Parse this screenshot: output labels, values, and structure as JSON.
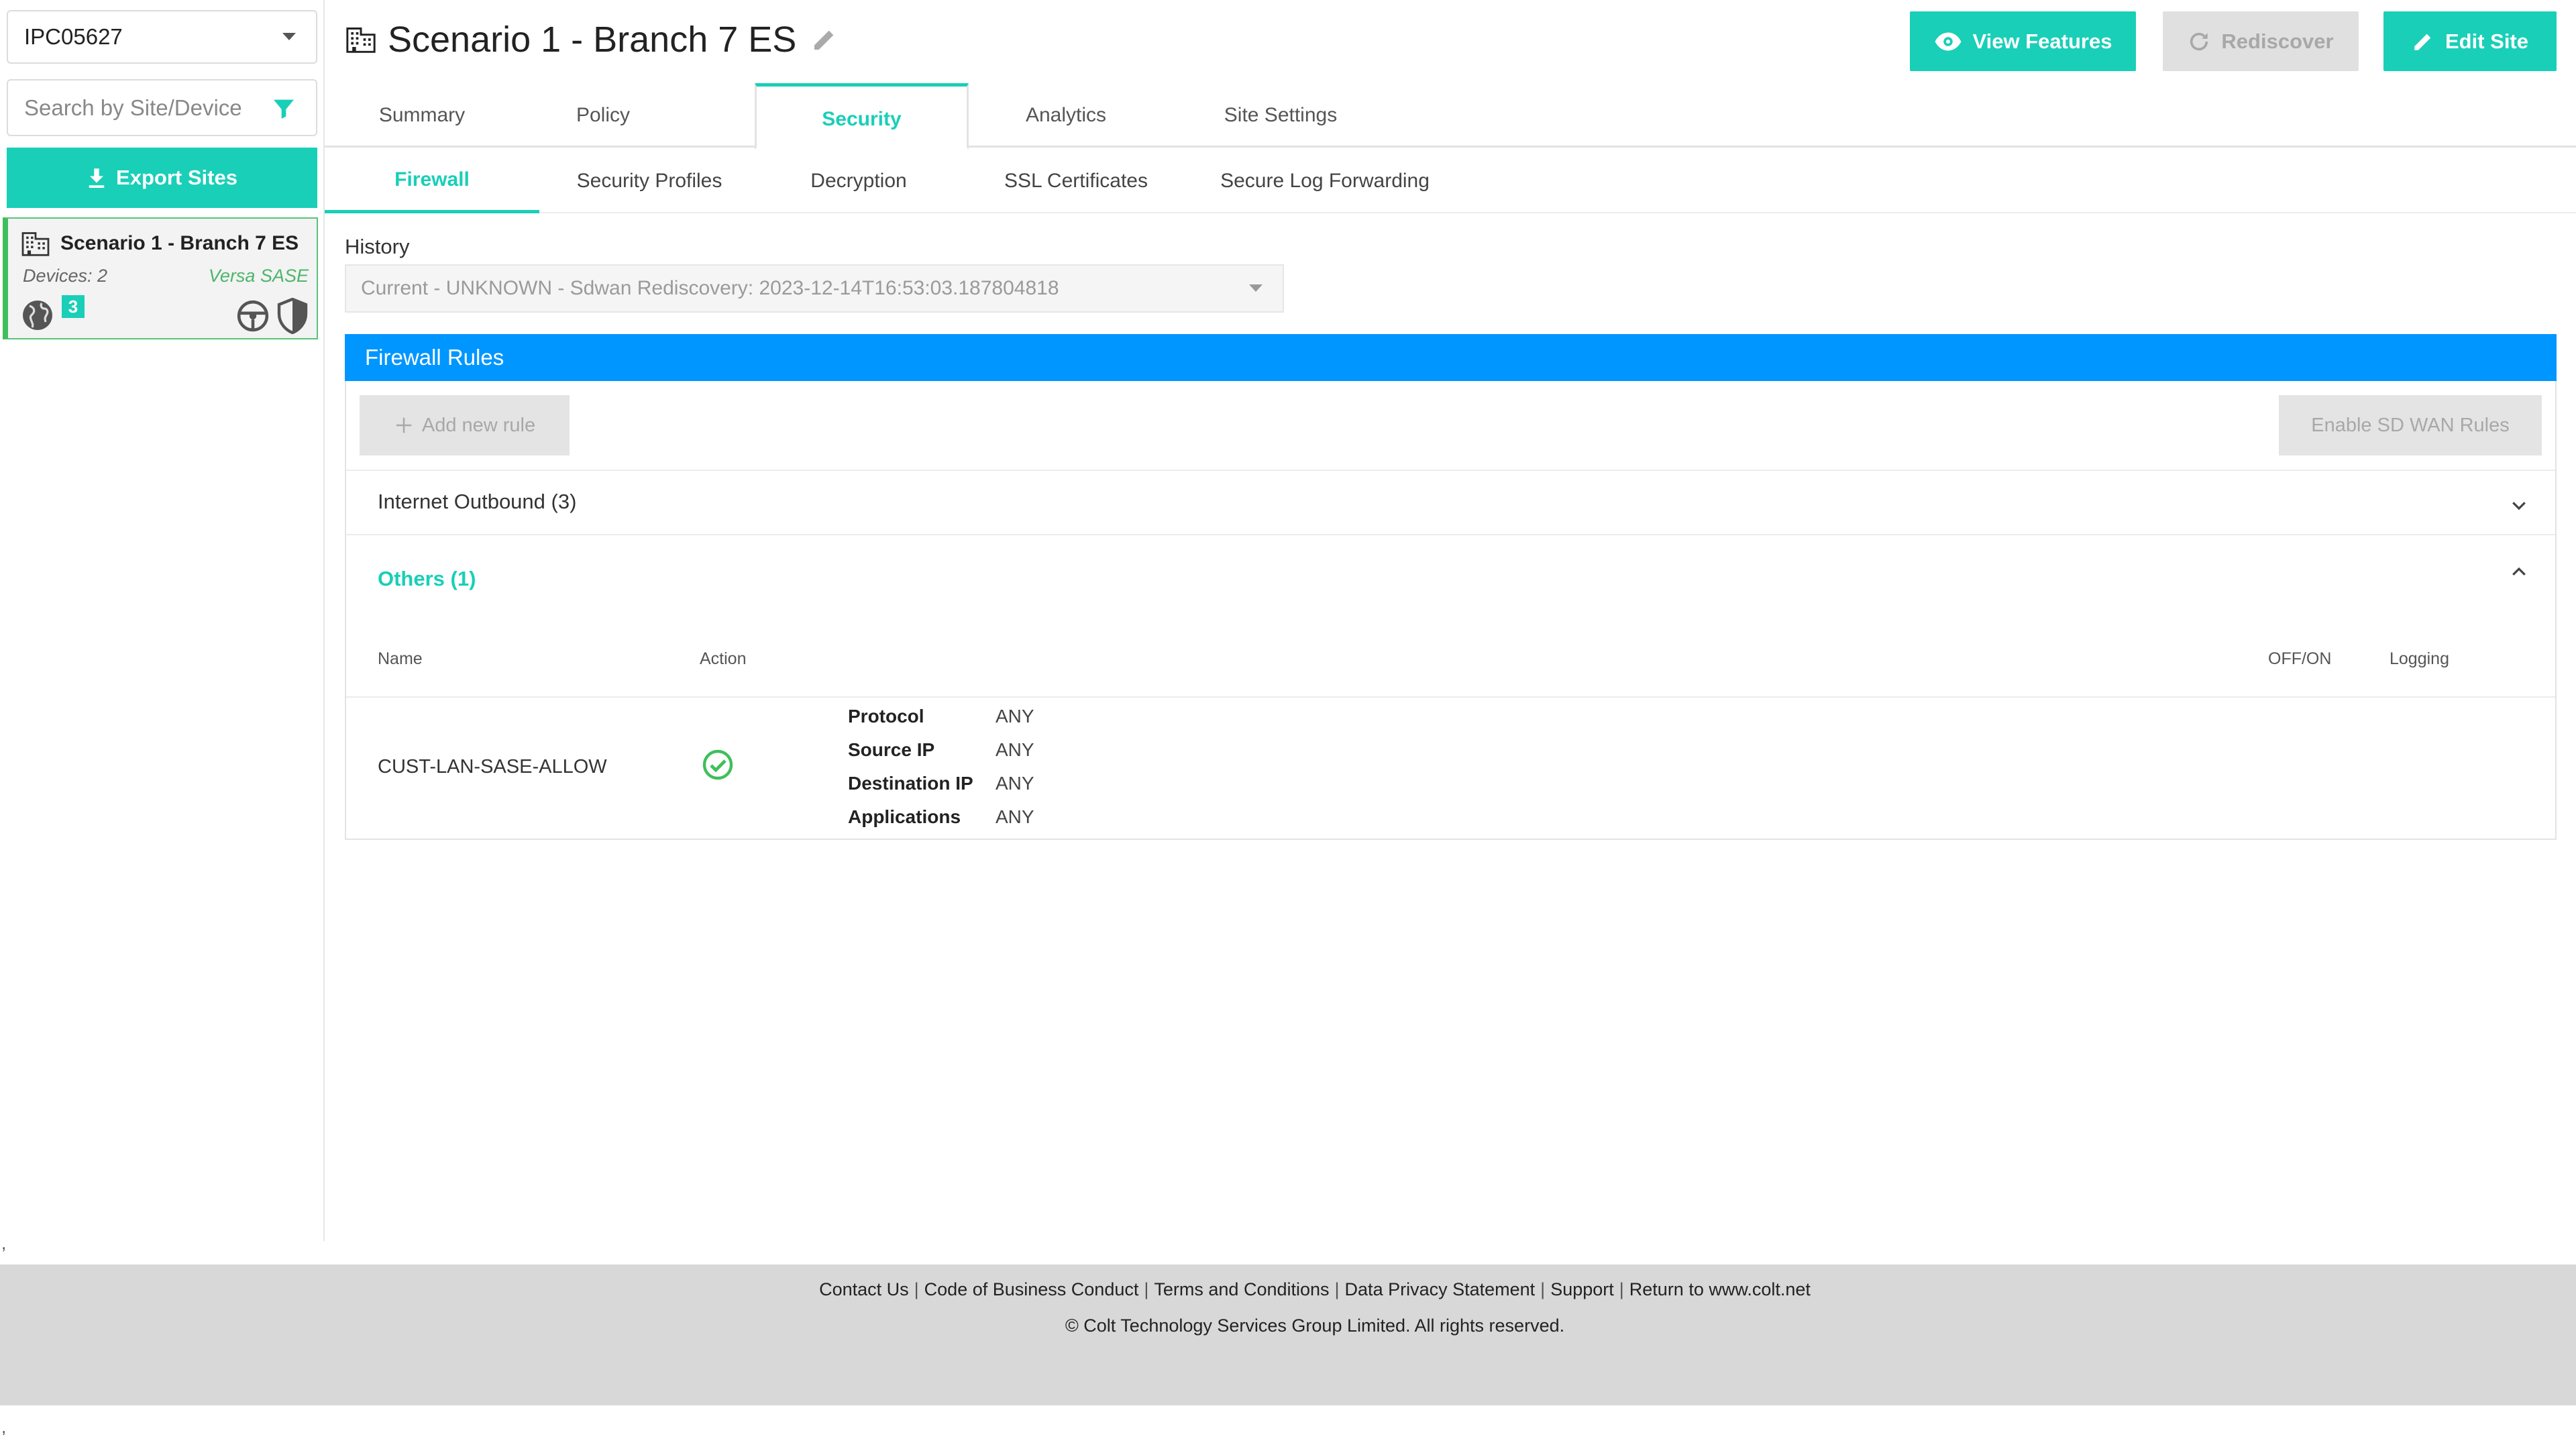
{
  "sidebar": {
    "customer_select": "IPC05627",
    "search_placeholder": "Search by Site/Device",
    "export_label": "Export Sites",
    "site_card": {
      "name": "Scenario 1 - Branch 7 ES",
      "devices": "Devices: 2",
      "vendor": "Versa SASE",
      "badge_count": "3"
    }
  },
  "header": {
    "title": "Scenario 1 - Branch 7 ES",
    "view_features": "View Features",
    "rediscover": "Rediscover",
    "edit_site": "Edit Site"
  },
  "tabs": [
    "Summary",
    "Policy",
    "Security",
    "Analytics",
    "Site Settings"
  ],
  "subtabs": [
    "Firewall",
    "Security Profiles",
    "Decryption",
    "SSL Certificates",
    "Secure Log Forwarding"
  ],
  "history": {
    "label": "History",
    "value": "Current - UNKNOWN - Sdwan Rediscovery: 2023-12-14T16:53:03.187804818"
  },
  "firewall": {
    "header": "Firewall Rules",
    "add_rule": "Add new rule",
    "enable_sdwan": "Enable SD WAN Rules",
    "groups": [
      "Internet Outbound (3)",
      "Others (1)"
    ],
    "columns": {
      "name": "Name",
      "action": "Action",
      "offon": "OFF/ON",
      "logging": "Logging"
    },
    "rule": {
      "name": "CUST-LAN-SASE-ALLOW",
      "details": [
        {
          "key": "Protocol",
          "value": "ANY"
        },
        {
          "key": "Source IP",
          "value": "ANY"
        },
        {
          "key": "Destination IP",
          "value": "ANY"
        },
        {
          "key": "Applications",
          "value": "ANY"
        }
      ]
    }
  },
  "footer": {
    "links": [
      "Contact Us",
      "Code of Business Conduct",
      "Terms and Conditions",
      "Data Privacy Statement",
      "Support",
      "Return to www.colt.net"
    ],
    "separator": "|",
    "copyright": "© Colt Technology Services Group Limited. All rights reserved.",
    "tick": ","
  },
  "colors": {
    "accent": "#19cfb7",
    "header_blue": "#0096ff",
    "active_green": "#3fbf5b"
  }
}
